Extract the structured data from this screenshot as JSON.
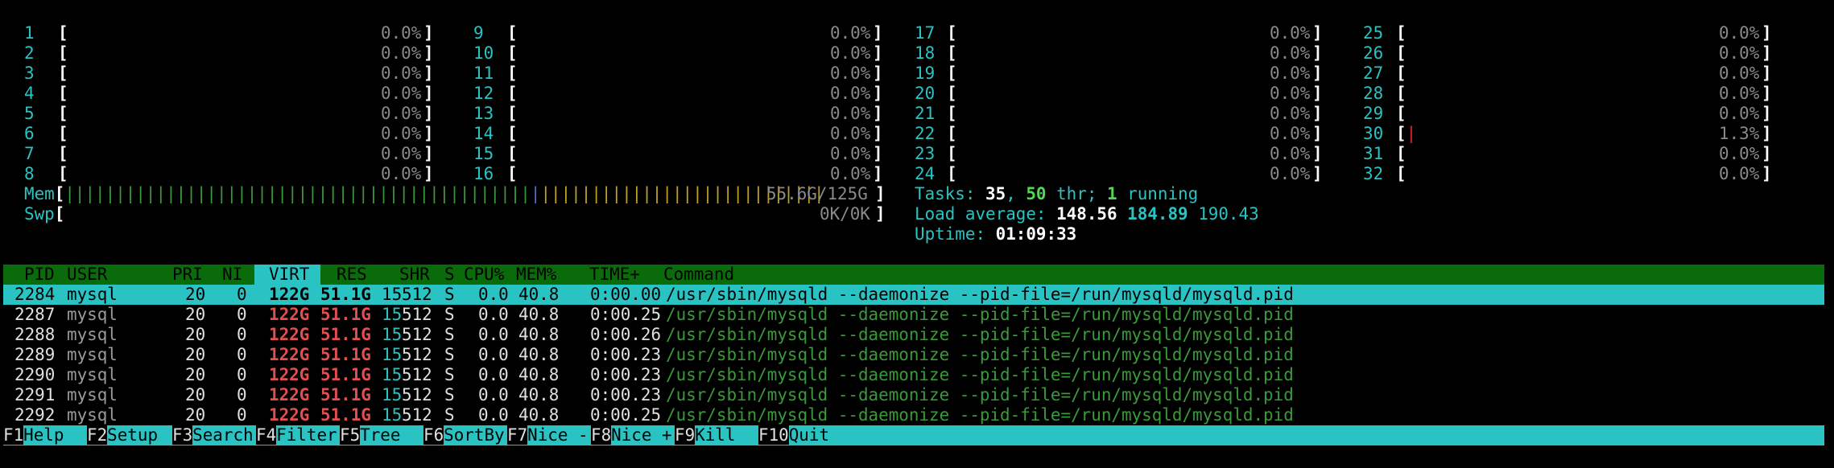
{
  "cpus": [
    {
      "id": "1",
      "pct": "0.0%"
    },
    {
      "id": "2",
      "pct": "0.0%"
    },
    {
      "id": "3",
      "pct": "0.0%"
    },
    {
      "id": "4",
      "pct": "0.0%"
    },
    {
      "id": "5",
      "pct": "0.0%"
    },
    {
      "id": "6",
      "pct": "0.0%"
    },
    {
      "id": "7",
      "pct": "0.0%"
    },
    {
      "id": "8",
      "pct": "0.0%"
    },
    {
      "id": "9",
      "pct": "0.0%"
    },
    {
      "id": "10",
      "pct": "0.0%"
    },
    {
      "id": "11",
      "pct": "0.0%"
    },
    {
      "id": "12",
      "pct": "0.0%"
    },
    {
      "id": "13",
      "pct": "0.0%"
    },
    {
      "id": "14",
      "pct": "0.0%"
    },
    {
      "id": "15",
      "pct": "0.0%"
    },
    {
      "id": "16",
      "pct": "0.0%"
    },
    {
      "id": "17",
      "pct": "0.0%"
    },
    {
      "id": "18",
      "pct": "0.0%"
    },
    {
      "id": "19",
      "pct": "0.0%"
    },
    {
      "id": "20",
      "pct": "0.0%"
    },
    {
      "id": "21",
      "pct": "0.0%"
    },
    {
      "id": "22",
      "pct": "0.0%"
    },
    {
      "id": "23",
      "pct": "0.0%"
    },
    {
      "id": "24",
      "pct": "0.0%"
    },
    {
      "id": "25",
      "pct": "0.0%"
    },
    {
      "id": "26",
      "pct": "0.0%"
    },
    {
      "id": "27",
      "pct": "0.0%"
    },
    {
      "id": "28",
      "pct": "0.0%"
    },
    {
      "id": "29",
      "pct": "0.0%"
    },
    {
      "id": "30",
      "pct": "1.3%"
    },
    {
      "id": "31",
      "pct": "0.0%"
    },
    {
      "id": "32",
      "pct": "0.0%"
    }
  ],
  "mem": {
    "label": "Mem",
    "value": "55.6G/125G",
    "fraction": 0.445
  },
  "swp": {
    "label": "Swp",
    "value": "0K/0K"
  },
  "tasks": {
    "label": "Tasks:",
    "count": "35",
    "threads": "50",
    "thr_label": "thr;",
    "running": "1",
    "running_label": "running"
  },
  "load": {
    "label": "Load average:",
    "one": "148.56",
    "five": "184.89",
    "fifteen": "190.43"
  },
  "uptime": {
    "label": "Uptime:",
    "value": "01:09:33"
  },
  "columns": [
    "PID",
    "USER",
    "PRI",
    "NI",
    "VIRT",
    "RES",
    "SHR",
    "S",
    "CPU%",
    "MEM%",
    "TIME+",
    "Command"
  ],
  "processes": [
    {
      "pid": "2284",
      "user": "mysql",
      "pri": "20",
      "ni": "0",
      "virt": "122G",
      "res": "51.1G",
      "shr_a": "15",
      "shr_b": "512",
      "s": "S",
      "cpu": "0.0",
      "mem": "40.8",
      "time": "0:00.00",
      "cmd": "/usr/sbin/mysqld --daemonize --pid-file=/run/mysqld/mysqld.pid"
    },
    {
      "pid": "2287",
      "user": "mysql",
      "pri": "20",
      "ni": "0",
      "virt": "122G",
      "res": "51.1G",
      "shr_a": "15",
      "shr_b": "512",
      "s": "S",
      "cpu": "0.0",
      "mem": "40.8",
      "time": "0:00.25",
      "cmd": "/usr/sbin/mysqld --daemonize --pid-file=/run/mysqld/mysqld.pid"
    },
    {
      "pid": "2288",
      "user": "mysql",
      "pri": "20",
      "ni": "0",
      "virt": "122G",
      "res": "51.1G",
      "shr_a": "15",
      "shr_b": "512",
      "s": "S",
      "cpu": "0.0",
      "mem": "40.8",
      "time": "0:00.26",
      "cmd": "/usr/sbin/mysqld --daemonize --pid-file=/run/mysqld/mysqld.pid"
    },
    {
      "pid": "2289",
      "user": "mysql",
      "pri": "20",
      "ni": "0",
      "virt": "122G",
      "res": "51.1G",
      "shr_a": "15",
      "shr_b": "512",
      "s": "S",
      "cpu": "0.0",
      "mem": "40.8",
      "time": "0:00.23",
      "cmd": "/usr/sbin/mysqld --daemonize --pid-file=/run/mysqld/mysqld.pid"
    },
    {
      "pid": "2290",
      "user": "mysql",
      "pri": "20",
      "ni": "0",
      "virt": "122G",
      "res": "51.1G",
      "shr_a": "15",
      "shr_b": "512",
      "s": "S",
      "cpu": "0.0",
      "mem": "40.8",
      "time": "0:00.23",
      "cmd": "/usr/sbin/mysqld --daemonize --pid-file=/run/mysqld/mysqld.pid"
    },
    {
      "pid": "2291",
      "user": "mysql",
      "pri": "20",
      "ni": "0",
      "virt": "122G",
      "res": "51.1G",
      "shr_a": "15",
      "shr_b": "512",
      "s": "S",
      "cpu": "0.0",
      "mem": "40.8",
      "time": "0:00.23",
      "cmd": "/usr/sbin/mysqld --daemonize --pid-file=/run/mysqld/mysqld.pid"
    },
    {
      "pid": "2292",
      "user": "mysql",
      "pri": "20",
      "ni": "0",
      "virt": "122G",
      "res": "51.1G",
      "shr_a": "15",
      "shr_b": "512",
      "s": "S",
      "cpu": "0.0",
      "mem": "40.8",
      "time": "0:00.25",
      "cmd": "/usr/sbin/mysqld --daemonize --pid-file=/run/mysqld/mysqld.pid"
    }
  ],
  "footer": [
    {
      "key": "F1",
      "label": "Help"
    },
    {
      "key": "F2",
      "label": "Setup"
    },
    {
      "key": "F3",
      "label": "Search"
    },
    {
      "key": "F4",
      "label": "Filter"
    },
    {
      "key": "F5",
      "label": "Tree"
    },
    {
      "key": "F6",
      "label": "SortBy"
    },
    {
      "key": "F7",
      "label": "Nice -"
    },
    {
      "key": "F8",
      "label": "Nice +"
    },
    {
      "key": "F9",
      "label": "Kill"
    },
    {
      "key": "F10",
      "label": "Quit"
    }
  ],
  "colors": {
    "cyan": "#2ac3c3",
    "header_green": "#0a6b0a",
    "cmd_green": "#3a9a3a",
    "red": "#e05050"
  }
}
